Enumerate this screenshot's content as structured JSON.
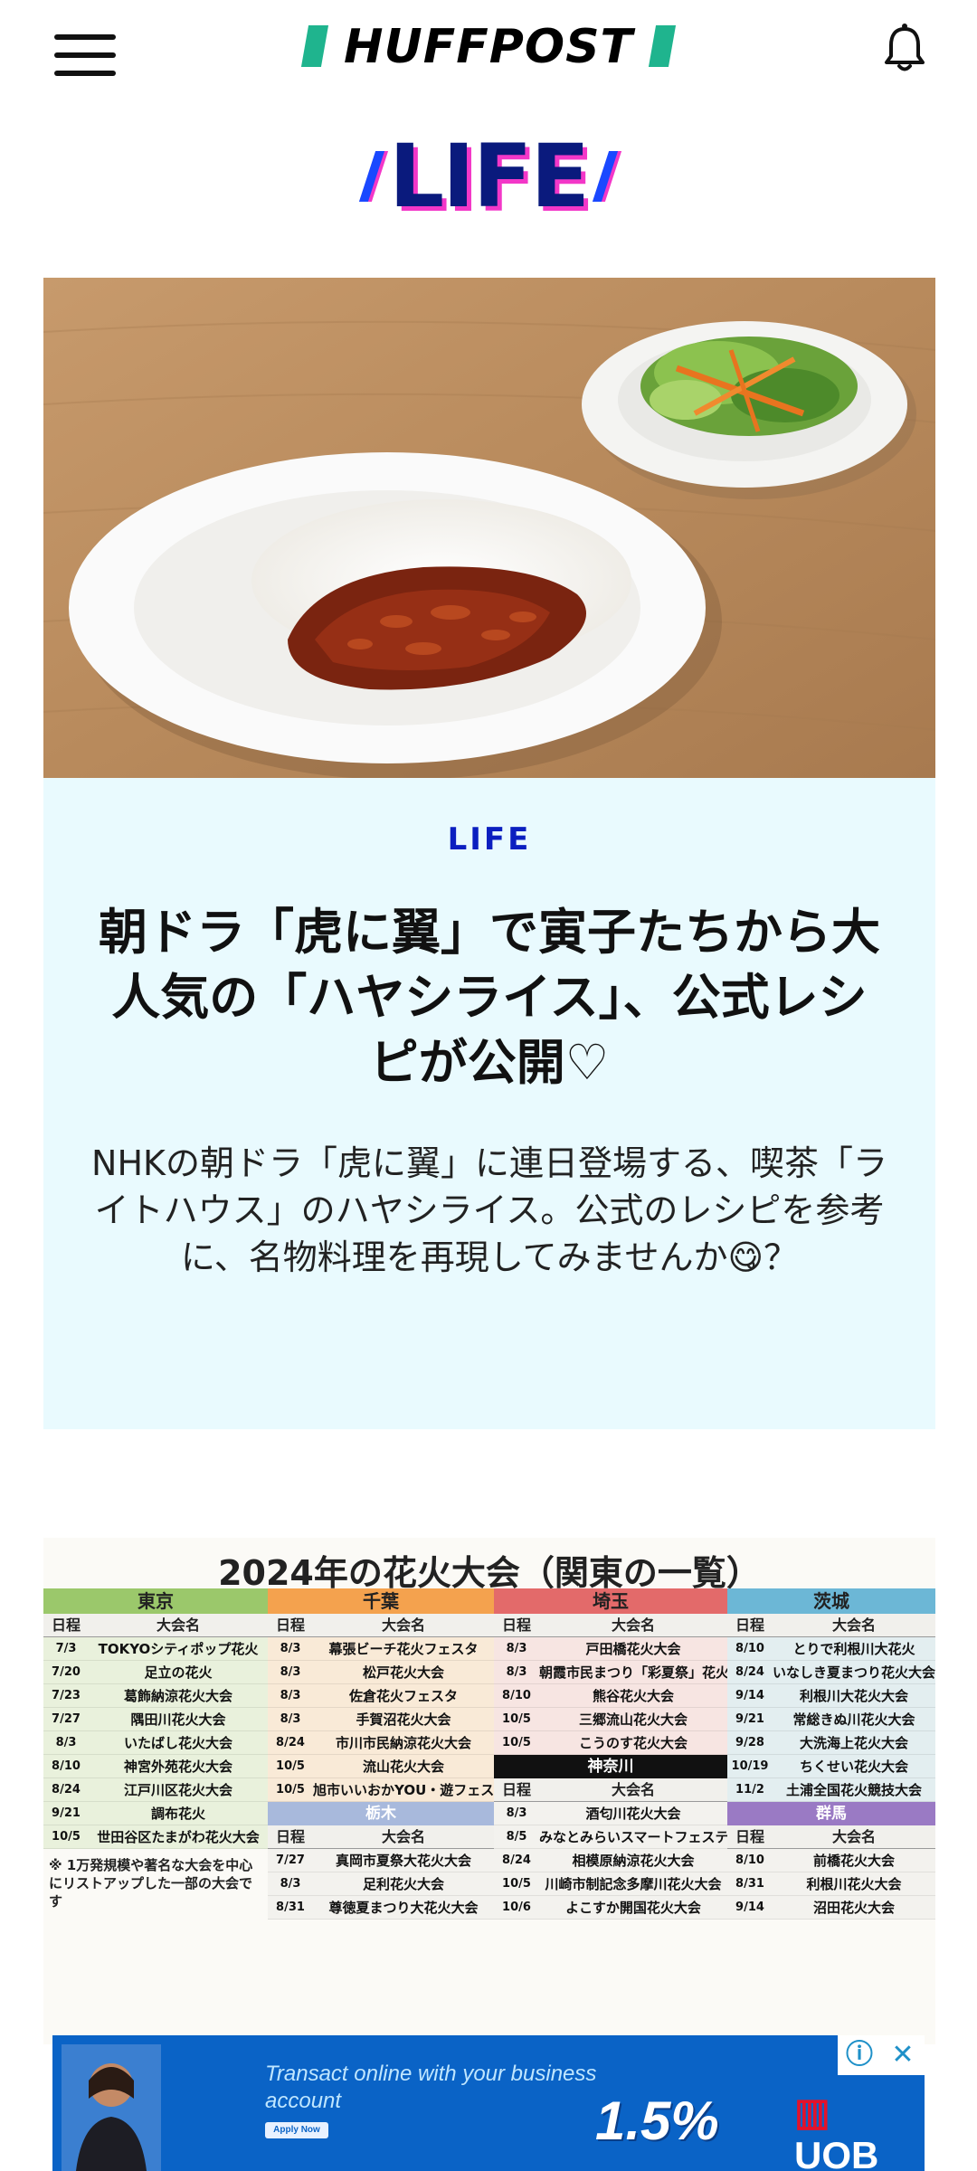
{
  "header": {
    "logo_text": "HUFFPOST",
    "menu_icon": "hamburger-menu-icon",
    "notification_icon": "bell-icon"
  },
  "section": {
    "title": "LIFE"
  },
  "article": {
    "category": "LIFE",
    "title": "朝ドラ「虎に翼」で寅子たちから大人気の「ハヤシライス」、公式レシピが公開♡",
    "description": "NHKの朝ドラ「虎に翼」に連日登場する、喫茶「ライトハウス」のハヤシライス。公式のレシピを参考に、名物料理を再現してみませんか😋？"
  },
  "fireworks_image": {
    "title": "2024年の花火大会（関東の一覧）",
    "date_header": "日程",
    "name_header": "大会名",
    "columns": [
      {
        "region": "東京",
        "color": "#9bc86b",
        "rows": [
          {
            "date": "7/3",
            "name": "TOKYOシティポップ花火"
          },
          {
            "date": "7/20",
            "name": "足立の花火"
          },
          {
            "date": "7/23",
            "name": "葛飾納涼花火大会"
          },
          {
            "date": "7/27",
            "name": "隅田川花火大会"
          },
          {
            "date": "8/3",
            "name": "いたばし花火大会"
          },
          {
            "date": "8/10",
            "name": "神宮外苑花火大会"
          },
          {
            "date": "8/24",
            "name": "江戸川区花火大会"
          },
          {
            "date": "9/21",
            "name": "調布花火"
          },
          {
            "date": "10/5",
            "name": "世田谷区たまがわ花火大会"
          }
        ],
        "note": "※ 1万発規模や著名な大会を中心にリストアップした一部の大会です"
      },
      {
        "region": "千葉",
        "color": "#f4a24e",
        "rows": [
          {
            "date": "8/3",
            "name": "幕張ビーチ花火フェスタ"
          },
          {
            "date": "8/3",
            "name": "松戸花火大会"
          },
          {
            "date": "8/3",
            "name": "佐倉花火フェスタ"
          },
          {
            "date": "8/3",
            "name": "手賀沼花火大会"
          },
          {
            "date": "8/24",
            "name": "市川市民納涼花火大会"
          },
          {
            "date": "10/5",
            "name": "流山花火大会"
          },
          {
            "date": "10/5",
            "name": "旭市いいおかYOU・遊フェスティバル"
          }
        ],
        "sub_region": "栃木",
        "sub_color": "#a8b9dc",
        "sub_rows": [
          {
            "date": "7/27",
            "name": "真岡市夏祭大花火大会"
          },
          {
            "date": "8/3",
            "name": "足利花火大会"
          },
          {
            "date": "8/31",
            "name": "尊徳夏まつり大花火大会"
          }
        ]
      },
      {
        "region": "埼玉",
        "color": "#e36a6a",
        "rows": [
          {
            "date": "8/3",
            "name": "戸田橋花火大会"
          },
          {
            "date": "8/3",
            "name": "朝霞市民まつり「彩夏祭」花火大会"
          },
          {
            "date": "8/10",
            "name": "熊谷花火大会"
          },
          {
            "date": "10/5",
            "name": "三郷流山花火大会"
          },
          {
            "date": "10/5",
            "name": "こうのす花火大会"
          }
        ],
        "sub_region": "神奈川",
        "sub_color": "#111111",
        "sub_rows": [
          {
            "date": "8/3",
            "name": "酒匂川花火大会"
          },
          {
            "date": "8/5",
            "name": "みなとみらいスマートフェスティバル"
          },
          {
            "date": "8/24",
            "name": "相模原納涼花火大会"
          },
          {
            "date": "10/5",
            "name": "川崎市制記念多摩川花火大会"
          },
          {
            "date": "10/6",
            "name": "よこすか開国花火大会"
          }
        ]
      },
      {
        "region": "茨城",
        "color": "#6cb7d6",
        "rows": [
          {
            "date": "8/10",
            "name": "とりで利根川大花火"
          },
          {
            "date": "8/24",
            "name": "いなしき夏まつり花火大会"
          },
          {
            "date": "9/14",
            "name": "利根川大花火大会"
          },
          {
            "date": "9/21",
            "name": "常総きぬ川花火大会"
          },
          {
            "date": "9/28",
            "name": "大洗海上花火大会"
          },
          {
            "date": "10/19",
            "name": "ちくせい花火大会"
          },
          {
            "date": "11/2",
            "name": "土浦全国花火競技大会"
          }
        ],
        "sub_region": "群馬",
        "sub_color": "#9a7ac4",
        "sub_rows": [
          {
            "date": "8/10",
            "name": "前橋花火大会"
          },
          {
            "date": "8/31",
            "name": "利根川花火大会"
          },
          {
            "date": "9/14",
            "name": "沼田花火大会"
          }
        ]
      }
    ]
  },
  "ad": {
    "headline": "Transact online with your business account",
    "apply_label": "Apply Now",
    "rate": "1.5%",
    "brand": "UOB",
    "brand_mark": "▥",
    "info_icon": "info-icon",
    "close_icon": "close-icon",
    "info_glyph": "ⓘ",
    "close_glyph": "✕"
  }
}
